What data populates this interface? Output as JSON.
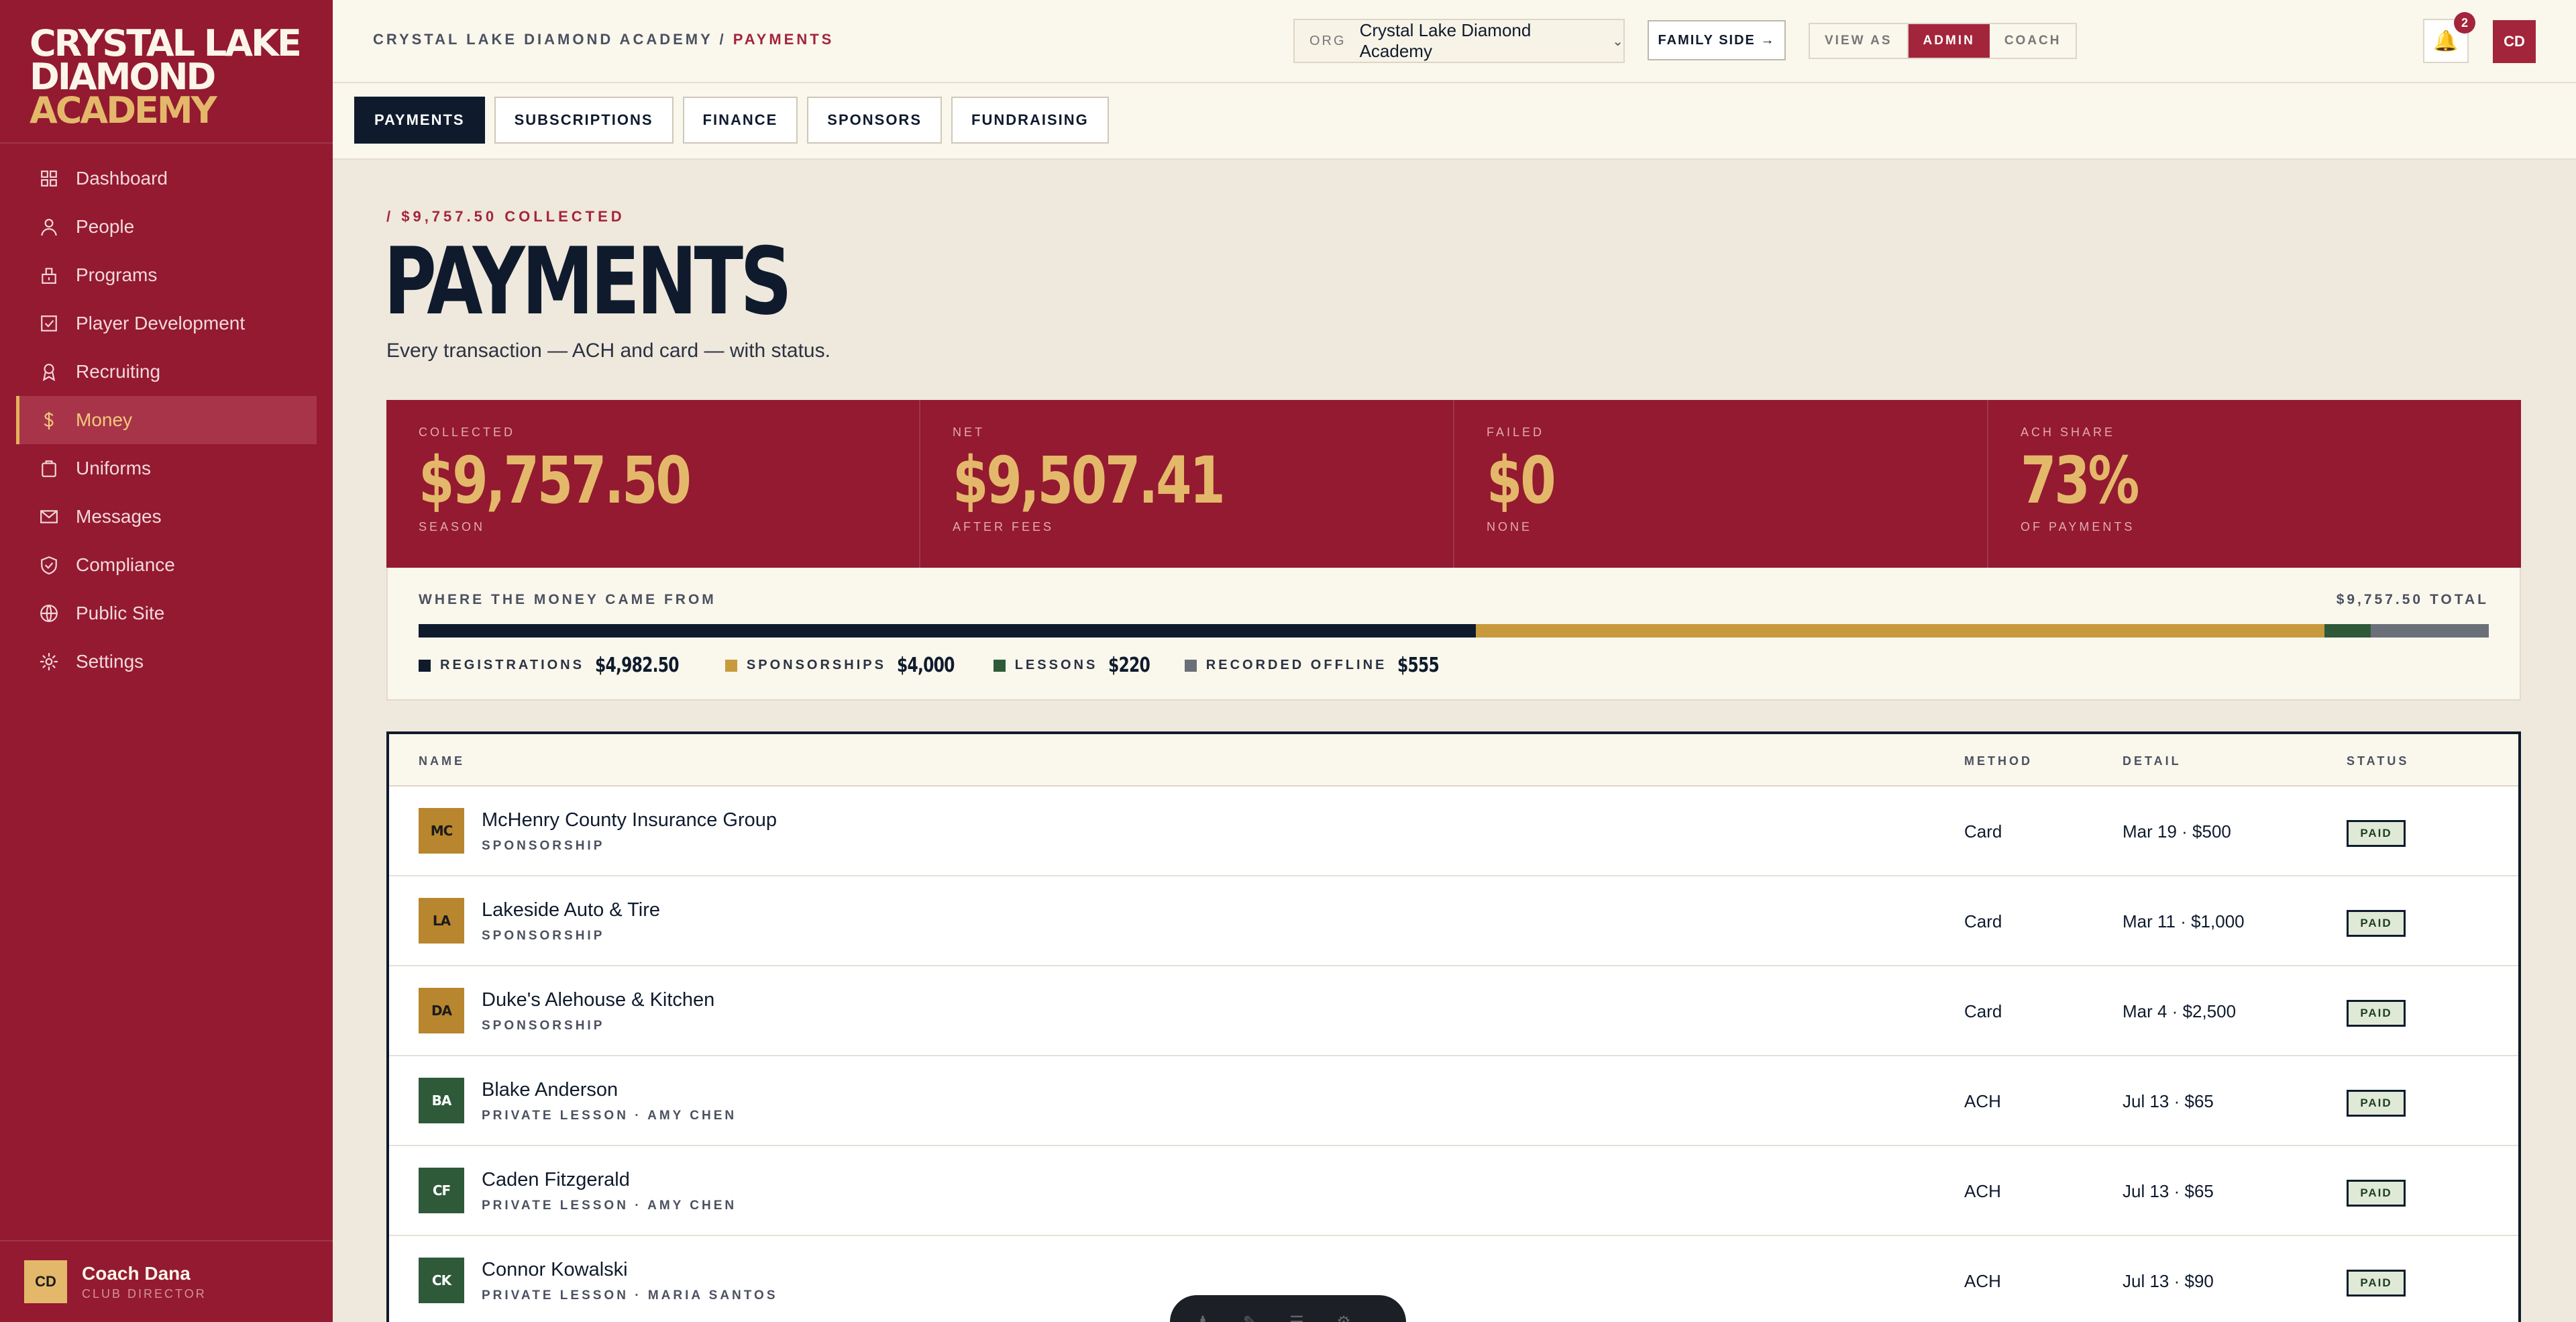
{
  "logo": {
    "line1": "Crystal Lake",
    "line2": "Diamond",
    "line3": "Academy"
  },
  "sidebar": {
    "items": [
      {
        "label": "Dashboard",
        "icon": "grid-icon"
      },
      {
        "label": "People",
        "icon": "person-icon"
      },
      {
        "label": "Programs",
        "icon": "clipboard-icon"
      },
      {
        "label": "Player Development",
        "icon": "checkbox-icon"
      },
      {
        "label": "Recruiting",
        "icon": "award-icon"
      },
      {
        "label": "Money",
        "icon": "dollar-icon",
        "active": true
      },
      {
        "label": "Uniforms",
        "icon": "shirt-icon"
      },
      {
        "label": "Messages",
        "icon": "mail-icon"
      },
      {
        "label": "Compliance",
        "icon": "shield-icon"
      },
      {
        "label": "Public Site",
        "icon": "globe-icon"
      },
      {
        "label": "Settings",
        "icon": "gear-icon"
      }
    ],
    "user": {
      "initials": "CD",
      "name": "Coach Dana",
      "role": "Club Director"
    }
  },
  "topbar": {
    "breadcrumb_org": "Crystal Lake Diamond Academy",
    "breadcrumb_sep": " / ",
    "breadcrumb_page": "Payments",
    "org_label": "ORG",
    "org_value": "Crystal Lake Diamond Academy",
    "family_side": "FAMILY SIDE →",
    "view_as_label": "View as",
    "view_as_options": [
      "Admin",
      "Coach"
    ],
    "view_as_selected": "Admin",
    "notification_count": "2",
    "avatar_initials": "CD"
  },
  "tabs": [
    "Payments",
    "Subscriptions",
    "Finance",
    "Sponsors",
    "Fundraising"
  ],
  "active_tab": "Payments",
  "header": {
    "eyebrow": "/ $9,757.50 Collected",
    "title": "Payments",
    "subtitle": "Every transaction — ACH and card — with status."
  },
  "stats": [
    {
      "label": "Collected",
      "value": "$9,757.50",
      "sub": "Season"
    },
    {
      "label": "Net",
      "value": "$9,507.41",
      "sub": "After fees"
    },
    {
      "label": "Failed",
      "value": "$0",
      "sub": "None"
    },
    {
      "label": "ACH Share",
      "value": "73%",
      "sub": "Of payments"
    }
  ],
  "breakdown": {
    "title": "Where the money came from",
    "total_text": "$9,757.50 Total",
    "segments": [
      {
        "label": "Registrations",
        "value_text": "$4,982.50",
        "amount": 4982.5,
        "color": "#0f1b2d"
      },
      {
        "label": "Sponsorships",
        "value_text": "$4,000",
        "amount": 4000,
        "color": "#c99a3d"
      },
      {
        "label": "Lessons",
        "value_text": "$220",
        "amount": 220,
        "color": "#2e5a3a"
      },
      {
        "label": "Recorded Offline",
        "value_text": "$555",
        "amount": 555,
        "color": "#6b6f78"
      }
    ]
  },
  "table": {
    "columns": [
      "Name",
      "Method",
      "Detail",
      "Status"
    ],
    "rows": [
      {
        "initials": "MC",
        "name": "McHenry County Insurance Group",
        "sub": "Sponsorship",
        "method": "Card",
        "detail": "Mar 19 · $500",
        "status": "PAID",
        "avatar_color": "#b8862e",
        "avatar_text": "#1b1b1b"
      },
      {
        "initials": "LA",
        "name": "Lakeside Auto & Tire",
        "sub": "Sponsorship",
        "method": "Card",
        "detail": "Mar 11 · $1,000",
        "status": "PAID",
        "avatar_color": "#b8862e",
        "avatar_text": "#1b1b1b"
      },
      {
        "initials": "DA",
        "name": "Duke's Alehouse & Kitchen",
        "sub": "Sponsorship",
        "method": "Card",
        "detail": "Mar 4 · $2,500",
        "status": "PAID",
        "avatar_color": "#b8862e",
        "avatar_text": "#1b1b1b"
      },
      {
        "initials": "BA",
        "name": "Blake Anderson",
        "sub": "Private Lesson · Amy Chen",
        "method": "ACH",
        "detail": "Jul 13 · $65",
        "status": "PAID",
        "avatar_color": "#2e5a3a",
        "avatar_text": "#ffffff"
      },
      {
        "initials": "CF",
        "name": "Caden Fitzgerald",
        "sub": "Private Lesson · Amy Chen",
        "method": "ACH",
        "detail": "Jul 13 · $65",
        "status": "PAID",
        "avatar_color": "#2e5a3a",
        "avatar_text": "#ffffff"
      },
      {
        "initials": "CK",
        "name": "Connor Kowalski",
        "sub": "Private Lesson · Maria Santos",
        "method": "ACH",
        "detail": "Jul 13 · $90",
        "status": "PAID",
        "avatar_color": "#2e5a3a",
        "avatar_text": "#ffffff"
      }
    ]
  },
  "colors": {
    "brand": "#931a30",
    "accent": "#e4b86a",
    "ink": "#0f1b2d",
    "paper": "#faf7ec"
  }
}
